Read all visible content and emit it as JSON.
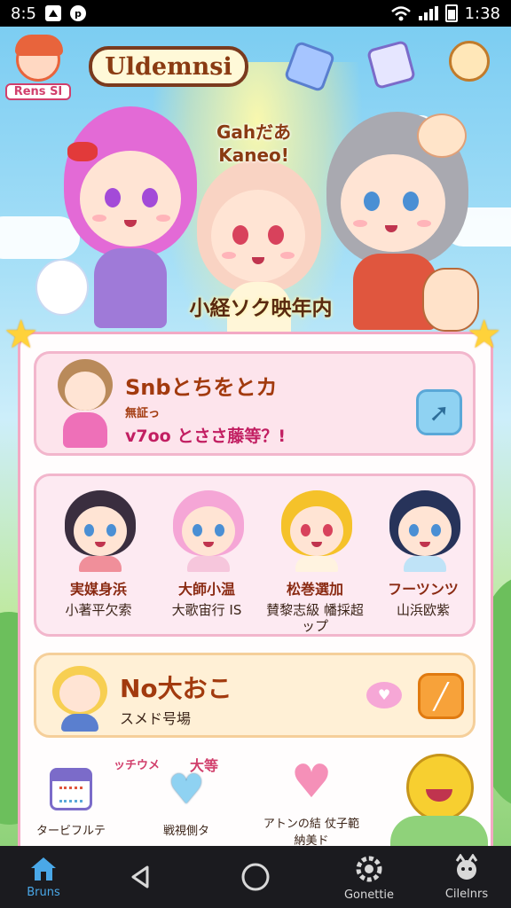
{
  "status_bar": {
    "time_left": "8:5",
    "time_right": "1:38"
  },
  "header": {
    "badge_label": "Rens SI",
    "title": "Uldemnsi"
  },
  "hero": {
    "caption_line1": "Gahだあ",
    "caption_line2": "Kaneo!",
    "banner": "小経ソク映年内"
  },
  "search_card": {
    "title": "Snbとちをとカ",
    "subtitle_small": "無証っ",
    "subtitle": "v7oo とささ藤等？!"
  },
  "characters": [
    {
      "name": "実媒身浜",
      "desc": "小著平欠索",
      "hair": "#3a2e3f",
      "eye": "#4a8fd4",
      "body": "#f08f9a"
    },
    {
      "name": "大師小温",
      "desc": "大歌宙行 IS",
      "hair": "#f5a6d6",
      "eye": "#4a8fd4",
      "body": "#f6c6dc"
    },
    {
      "name": "松巻選加",
      "desc": "賛黎志級 幡採超ップ",
      "hair": "#f5c22a",
      "eye": "#d8425c",
      "body": "#fff3e0"
    },
    {
      "name": "フーツンツ",
      "desc": "山浜欧紫",
      "hair": "#27335a",
      "eye": "#4a8fd4",
      "body": "#bfe3f7"
    }
  ],
  "note_card": {
    "title": "No大おこ",
    "subtitle": "スメド号場"
  },
  "quick_actions": {
    "heading_left": "ッチウメ",
    "heading_right": "大等",
    "items": [
      {
        "label": "タービフルテ"
      },
      {
        "label": "戦視側タ"
      },
      {
        "label": "アトンの結 仗子範納美ド"
      }
    ]
  },
  "nav": {
    "home_label": "Bruns",
    "settings_label": "Gonettie",
    "profile_label": "Cilelnrs"
  },
  "colors": {
    "pink_border": "#f2b6cc",
    "accent_orange": "#f7a23a",
    "accent_blue": "#8fd2f2"
  },
  "icons": [
    "wifi-icon",
    "signal-icon",
    "battery-icon",
    "arrow-right-icon",
    "pencil-icon",
    "heart-icon",
    "calendar-icon",
    "home-icon",
    "gear-icon",
    "back-icon"
  ]
}
